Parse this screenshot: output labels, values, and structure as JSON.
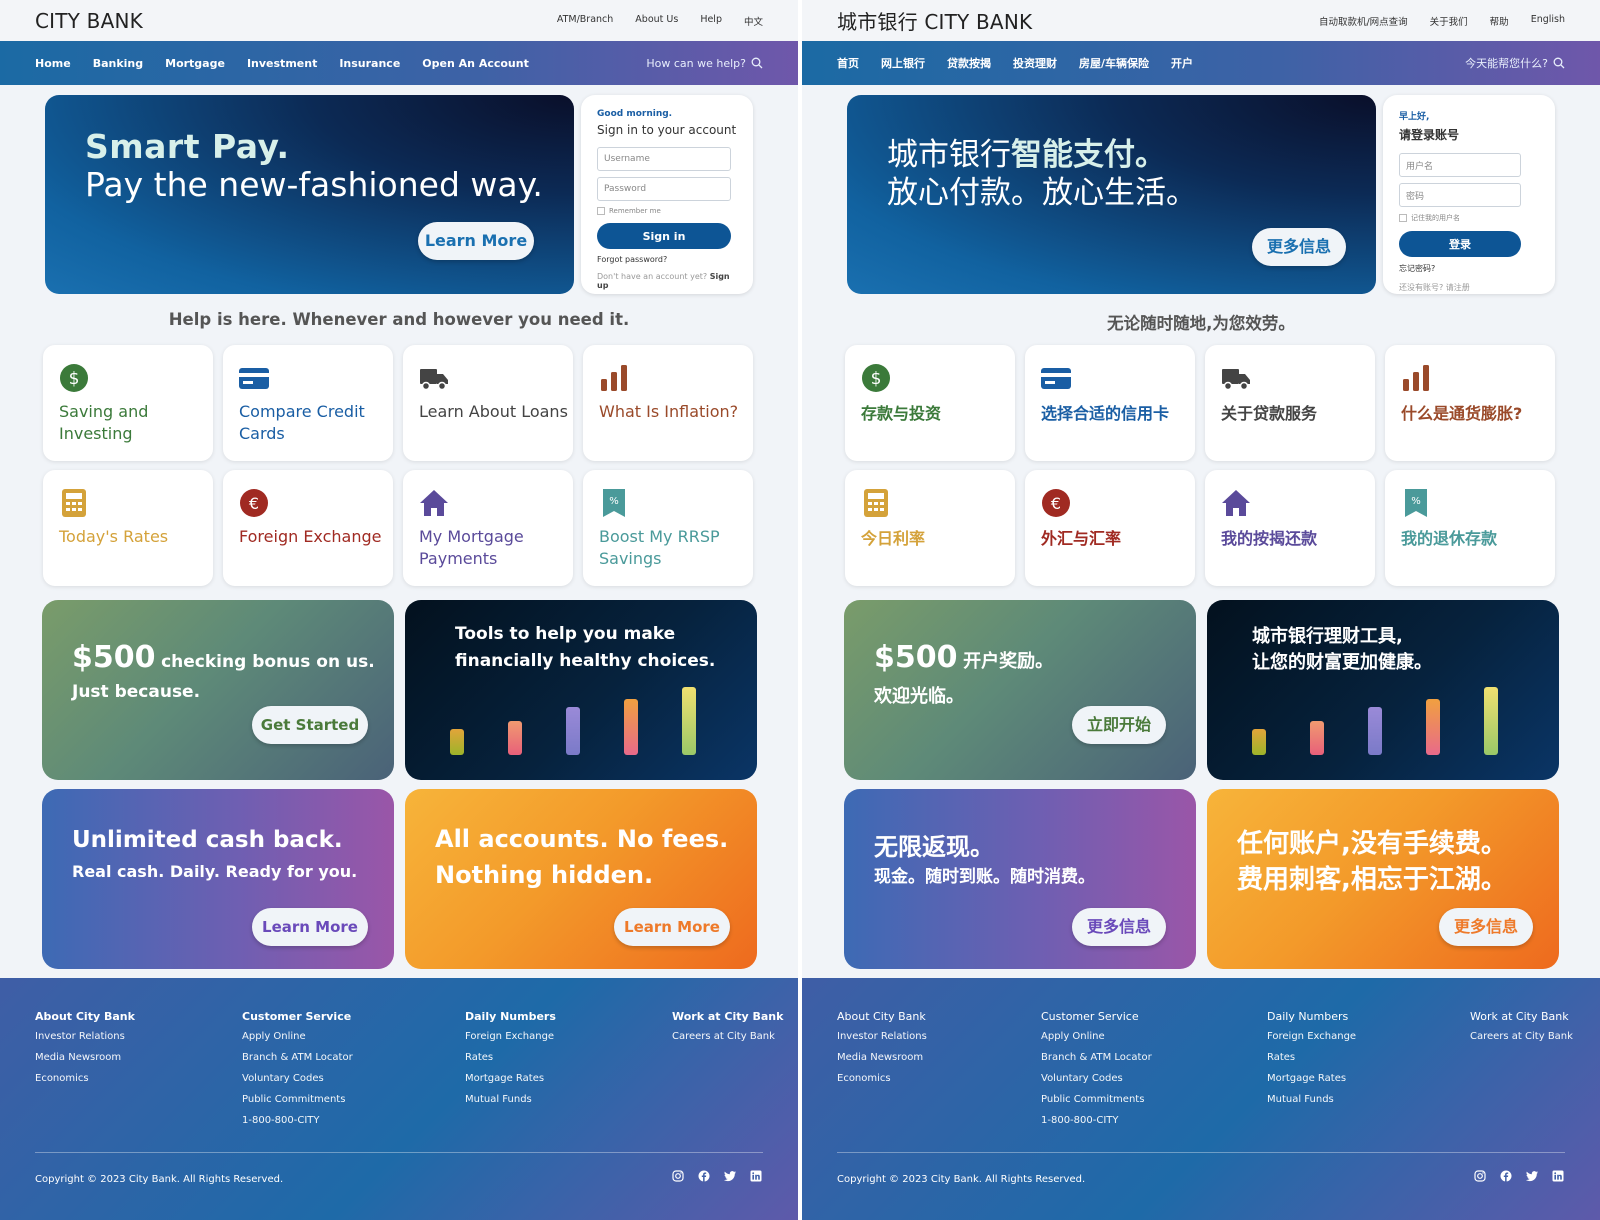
{
  "panels": [
    {
      "logo": "CITY BANK",
      "top_links": [
        "ATM/Branch",
        "About Us",
        "Help",
        "中文"
      ],
      "nav": [
        "Home",
        "Banking",
        "Mortgage",
        "Investment",
        "Insurance",
        "Open An Account"
      ],
      "search_text": "How can we help?",
      "hero": {
        "line1": "Smart Pay.",
        "line2": "Pay the new-fashioned way.",
        "button": "Learn More"
      },
      "login": {
        "greeting": "Good morning.",
        "title": "Sign in to your account",
        "username_placeholder": "Username",
        "password_placeholder": "Password",
        "remember": "Remember me",
        "button": "Sign in",
        "forgot": "Forgot password?",
        "no_account": "Don't have an account yet?",
        "signup": "Sign up"
      },
      "help_text": "Help is here. Whenever and however you need it.",
      "cards": [
        {
          "label": "Saving and Investing",
          "icon": "dollar-icon",
          "color": "#3b7a3a"
        },
        {
          "label": "Compare Credit Cards",
          "icon": "credit-card-icon",
          "color": "#1a5ea4"
        },
        {
          "label": "Learn About Loans",
          "icon": "truck-icon",
          "color": "#444444"
        },
        {
          "label": "What Is Inflation?",
          "icon": "bar-chart-icon",
          "color": "#9a4a2a"
        },
        {
          "label": "Today's Rates",
          "icon": "calculator-icon",
          "color": "#d4a23a"
        },
        {
          "label": "Foreign Exchange",
          "icon": "euro-icon",
          "color": "#a02a22"
        },
        {
          "label": "My Mortgage Payments",
          "icon": "house-icon",
          "color": "#5a4a9a"
        },
        {
          "label": "Boost My RRSP Savings",
          "icon": "percent-tag-icon",
          "color": "#4a9a9a"
        }
      ],
      "promos": {
        "bonus": {
          "amount": "$500",
          "rest": "checking bonus on us.",
          "line2": "Just because.",
          "button": "Get Started"
        },
        "tools": {
          "line1": "Tools to help you make",
          "line2": "financially healthy choices."
        },
        "cashback": {
          "line1": "Unlimited cash back.",
          "line2": "Real cash. Daily. Ready for you.",
          "button": "Learn More"
        },
        "nofees": {
          "line1": "All accounts. No fees.",
          "line2": "Nothing hidden.",
          "button": "Learn More"
        }
      },
      "footer": {
        "columns": [
          {
            "head": "About City Bank",
            "links": [
              "Investor Relations",
              "Media Newsroom",
              "Economics"
            ]
          },
          {
            "head": "Customer Service",
            "links": [
              "Apply Online",
              "Branch & ATM Locator",
              "Voluntary Codes",
              "Public Commitments",
              "1-800-800-CITY"
            ]
          },
          {
            "head": "Daily Numbers",
            "links": [
              "Foreign Exchange",
              "Rates",
              "Mortgage Rates",
              "Mutual Funds"
            ]
          },
          {
            "head": "Work at City Bank",
            "links": [
              "Careers at City Bank"
            ]
          }
        ],
        "copyright": "Copyright © 2023 City Bank. All Rights Reserved."
      }
    },
    {
      "logo": "城市银行 CITY BANK",
      "top_links": [
        "自动取款机/网点查询",
        "关于我们",
        "帮助",
        "English"
      ],
      "nav": [
        "首页",
        "网上银行",
        "贷款按揭",
        "投资理财",
        "房屋/车辆保险",
        "开户"
      ],
      "search_text": "今天能帮您什么?",
      "hero": {
        "line1_pre": "城市银行",
        "line1_bold": "智能支付。",
        "line2": "放心付款。放心生活。",
        "button": "更多信息"
      },
      "login": {
        "greeting": "早上好,",
        "title": "请登录账号",
        "username_placeholder": "用户名",
        "password_placeholder": "密码",
        "remember": "记住我的用户名",
        "button": "登录",
        "forgot": "忘记密码?",
        "no_account": "还没有账号? 请注册"
      },
      "help_text": "无论随时随地,为您效劳。",
      "cards": [
        {
          "label": "存款与投资",
          "icon": "dollar-icon",
          "color": "#3b7a3a"
        },
        {
          "label": "选择合适的信用卡",
          "icon": "credit-card-icon",
          "color": "#1a5ea4"
        },
        {
          "label": "关于贷款服务",
          "icon": "truck-icon",
          "color": "#444444"
        },
        {
          "label": "什么是通货膨胀?",
          "icon": "bar-chart-icon",
          "color": "#9a4a2a"
        },
        {
          "label": "今日利率",
          "icon": "calculator-icon",
          "color": "#d4a23a"
        },
        {
          "label": "外汇与汇率",
          "icon": "euro-icon",
          "color": "#a02a22"
        },
        {
          "label": "我的按揭还款",
          "icon": "house-icon",
          "color": "#5a4a9a"
        },
        {
          "label": "我的退休存款",
          "icon": "percent-tag-icon",
          "color": "#4a9a9a"
        }
      ],
      "promos": {
        "bonus": {
          "amount": "$500",
          "rest": "开户奖励。",
          "line2": "欢迎光临。",
          "button": "立即开始"
        },
        "tools": {
          "line1": "城市银行理财工具,",
          "line2": "让您的财富更加健康。"
        },
        "cashback": {
          "line1": "无限返现。",
          "line2": "现金。随时到账。随时消费。",
          "button": "更多信息"
        },
        "nofees": {
          "line1": "任何账户,没有手续费。",
          "line2": "费用刺客,相忘于江湖。",
          "button": "更多信息"
        }
      },
      "footer": {
        "columns": [
          {
            "head": "About City Bank",
            "links": [
              "Investor Relations",
              "Media Newsroom",
              "Economics"
            ]
          },
          {
            "head": "Customer Service",
            "links": [
              "Apply Online",
              "Branch & ATM Locator",
              "Voluntary Codes",
              "Public Commitments",
              "1-800-800-CITY"
            ]
          },
          {
            "head": "Daily Numbers",
            "links": [
              "Foreign Exchange",
              "Rates",
              "Mortgage Rates",
              "Mutual Funds"
            ]
          },
          {
            "head": "Work at City Bank",
            "links": [
              "Careers at City Bank"
            ]
          }
        ],
        "copyright": "Copyright © 2023 City Bank. All Rights Reserved."
      }
    }
  ]
}
